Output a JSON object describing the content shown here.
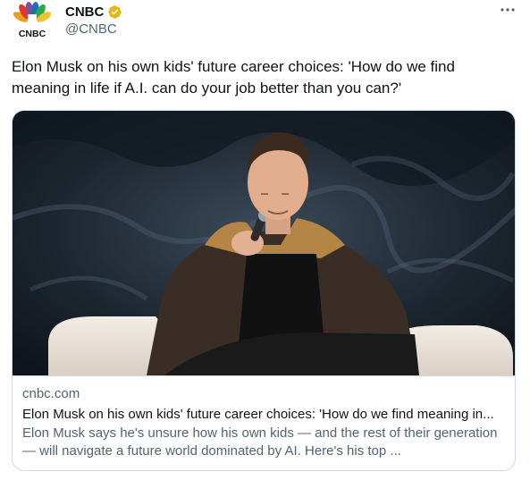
{
  "author": {
    "name": "CNBC",
    "handle": "@CNBC",
    "logo_text": "CNBC",
    "verified_color": "#e2b719"
  },
  "tweet": {
    "text": "Elon Musk on his own kids' future career choices: 'How do we find\nmeaning in life if A.I. can do your job better than you can?'"
  },
  "card": {
    "domain": "cnbc.com",
    "title": "Elon Musk on his own kids' future career choices: 'How do we find meaning in...",
    "description": "Elon Musk says he's unsure how his own kids — and the rest of their generation — will navigate a future world dominated by AI. Here's his top ..."
  },
  "icons": {
    "more": "more-horizontal-icon",
    "verified": "verified-badge-icon",
    "logo": "cnbc-peacock-logo"
  },
  "colors": {
    "text_primary": "#0f1419",
    "text_secondary": "#536471",
    "border": "#cfd9de"
  }
}
